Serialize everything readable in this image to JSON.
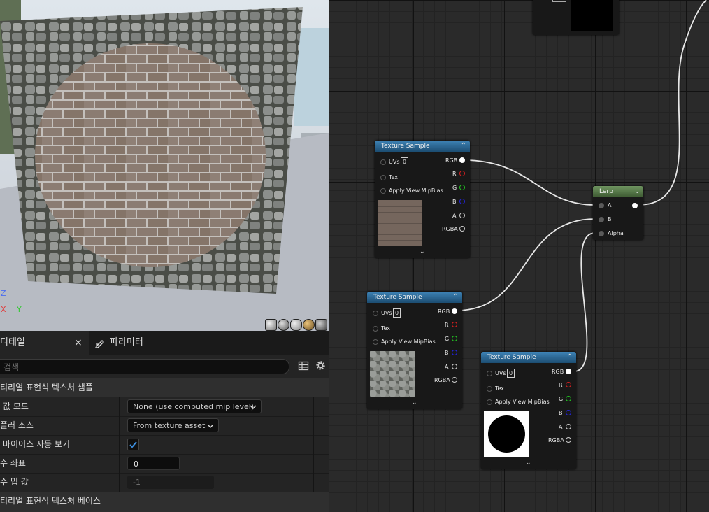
{
  "viewport": {
    "axis_z": "Z",
    "axis_x": "X",
    "axis_y": "Y"
  },
  "details": {
    "tab_details_label": "디테일",
    "tab_details_close": "×",
    "tab_params_label": "파라미터",
    "search_placeholder": "검색",
    "category1": "티리얼 표현식 텍스처 샘플",
    "rows": [
      {
        "label": "값 모드",
        "value": "None (use computed mip level)"
      },
      {
        "label": "플러 소스",
        "value": "From texture asset"
      },
      {
        "label": "바이어스 자동 보기",
        "checked": true
      },
      {
        "label": "수 좌표",
        "value": "0"
      },
      {
        "label": "수 밉 값",
        "value": "-1"
      }
    ],
    "category2": "티리얼 표현식 텍스처 베이스"
  },
  "graph": {
    "nodes": {
      "ts1": {
        "title": "Texture Sample",
        "uvs": "UVs",
        "uv_index": "0",
        "tex": "Tex",
        "apply": "Apply View MipBias",
        "rgb": "RGB",
        "r": "R",
        "g": "G",
        "b": "B",
        "a": "A",
        "rgba": "RGBA"
      },
      "ts2": {
        "title": "Texture Sample",
        "uvs": "UVs",
        "uv_index": "0",
        "tex": "Tex",
        "apply": "Apply View MipBias",
        "rgb": "RGB",
        "r": "R",
        "g": "G",
        "b": "B",
        "a": "A",
        "rgba": "RGBA"
      },
      "ts3": {
        "title": "Texture Sample",
        "uvs": "UVs",
        "uv_index": "0",
        "tex": "Tex",
        "apply": "Apply View MipBias",
        "rgb": "RGB",
        "r": "R",
        "g": "G",
        "b": "B",
        "a": "A",
        "rgba": "RGBA"
      },
      "lerp": {
        "title": "Lerp",
        "a": "A",
        "b": "B",
        "alpha": "Alpha"
      }
    }
  },
  "colors": {
    "node_header": "#2f6c9c",
    "lerp_header": "#5d7f4d",
    "pin_red": "#d42020",
    "pin_green": "#22c322",
    "pin_blue": "#2424d8",
    "check": "#3d8fe0"
  }
}
